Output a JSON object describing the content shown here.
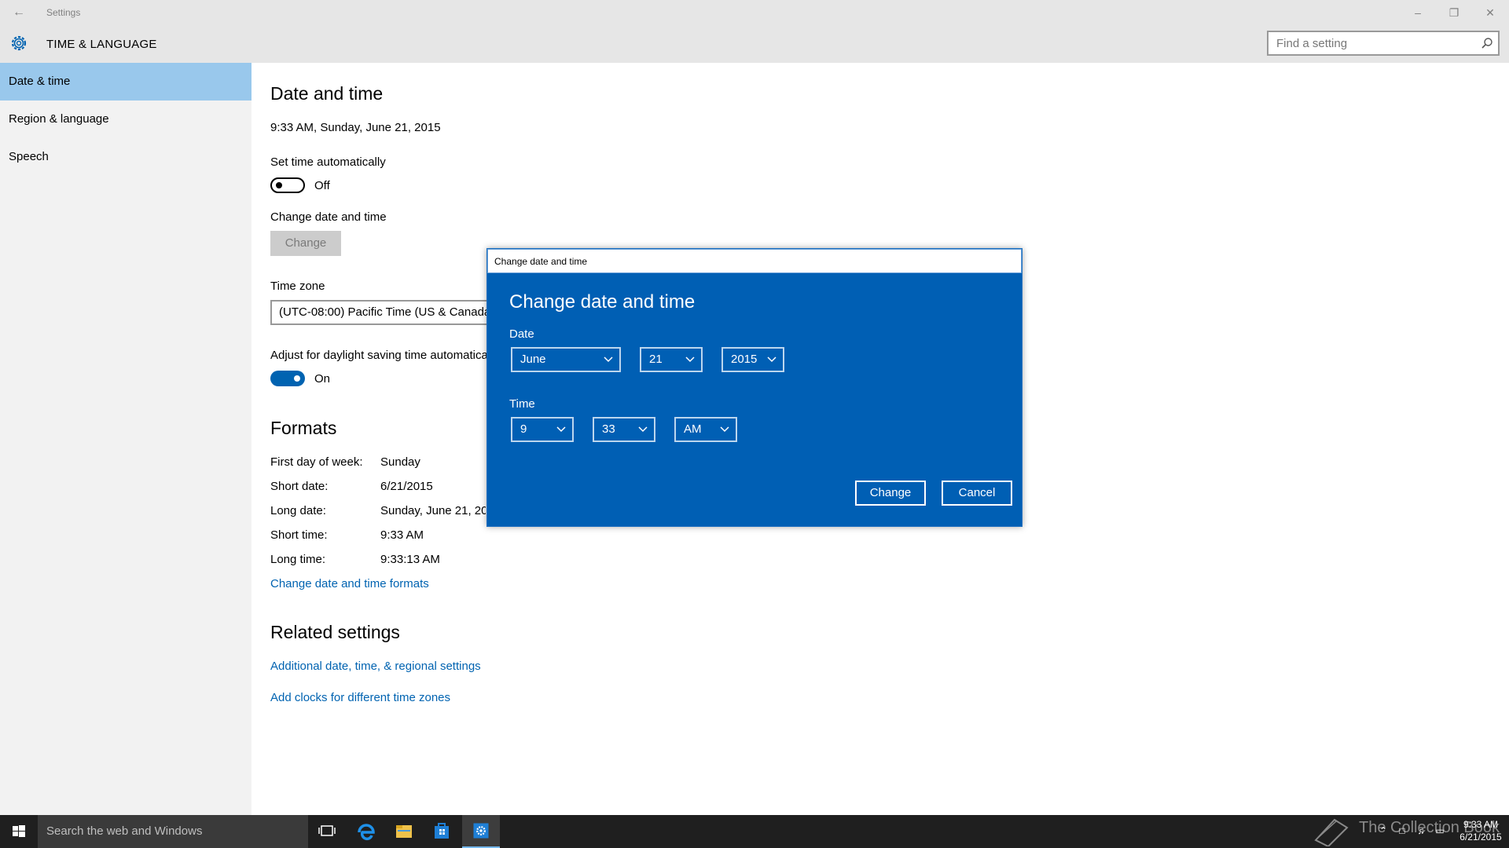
{
  "window": {
    "title": "Settings",
    "section_title": "TIME & LANGUAGE",
    "search_placeholder": "Find a setting"
  },
  "sidebar": {
    "items": [
      {
        "label": "Date & time",
        "active": true
      },
      {
        "label": "Region & language",
        "active": false
      },
      {
        "label": "Speech",
        "active": false
      }
    ]
  },
  "main": {
    "title": "Date and time",
    "current_datetime": "9:33 AM, Sunday, June 21, 2015",
    "set_time_auto_label": "Set time automatically",
    "set_time_auto_state": "Off",
    "change_label": "Change date and time",
    "change_button": "Change",
    "timezone_label": "Time zone",
    "timezone_value": "(UTC-08:00) Pacific Time (US & Canada)",
    "dst_label": "Adjust for daylight saving time automatically",
    "dst_state": "On",
    "formats_title": "Formats",
    "formats": [
      {
        "label": "First day of week:",
        "value": "Sunday"
      },
      {
        "label": "Short date:",
        "value": "6/21/2015"
      },
      {
        "label": "Long date:",
        "value": "Sunday, June 21, 2015"
      },
      {
        "label": "Short time:",
        "value": "9:33 AM"
      },
      {
        "label": "Long time:",
        "value": "9:33:13 AM"
      }
    ],
    "formats_link": "Change date and time formats",
    "related_title": "Related settings",
    "related_links": [
      "Additional date, time, & regional settings",
      "Add clocks for different time zones"
    ]
  },
  "dialog": {
    "window_title": "Change date and time",
    "heading": "Change date and time",
    "date_label": "Date",
    "month": "June",
    "day": "21",
    "year": "2015",
    "time_label": "Time",
    "hour": "9",
    "minute": "33",
    "ampm": "AM",
    "change_button": "Change",
    "cancel_button": "Cancel"
  },
  "taskbar": {
    "search_placeholder": "Search the web and Windows",
    "watermark": "The Collection Book",
    "clock_time": "9:33 AM",
    "clock_date": "6/21/2015"
  },
  "colors": {
    "accent": "#0063b1",
    "dialog_bg": "#005fb4",
    "sidebar_active": "#99c8ec"
  },
  "icons": {
    "header": "gear-icon",
    "search": "search-icon",
    "back": "back-arrow-icon"
  }
}
